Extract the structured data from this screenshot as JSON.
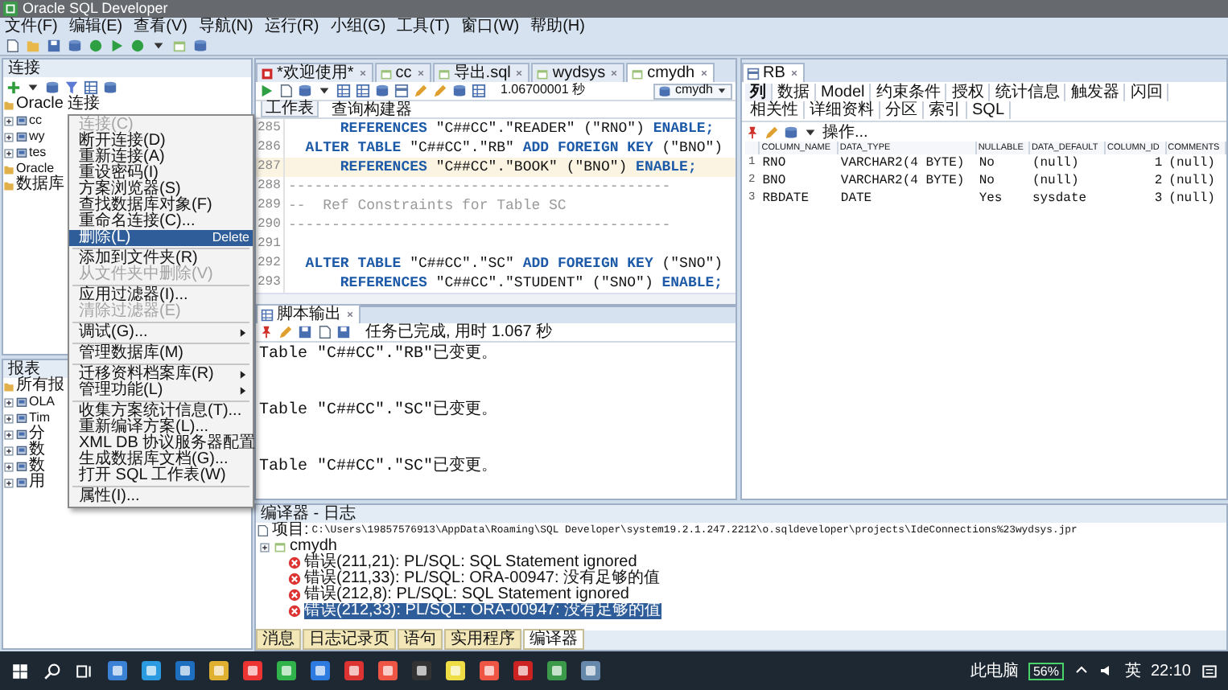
{
  "window": {
    "title": "Oracle SQL Developer"
  },
  "menu_bar": [
    "文件(F)",
    "编辑(E)",
    "查看(V)",
    "导航(N)",
    "运行(R)",
    "小组(G)",
    "工具(T)",
    "窗口(W)",
    "帮助(H)"
  ],
  "connections": {
    "title": "连接",
    "tree": [
      {
        "label": "Oracle 连接",
        "children": [
          {
            "label": "cc"
          },
          {
            "label": "wy"
          },
          {
            "label": "tes"
          }
        ]
      },
      {
        "label": "Oracle"
      },
      {
        "label": "数据库"
      }
    ]
  },
  "reports": {
    "title": "报表",
    "tree": [
      {
        "label": "所有报",
        "children": [
          {
            "label": "OLA"
          },
          {
            "label": "Tim"
          },
          {
            "label": "分"
          },
          {
            "label": "数"
          },
          {
            "label": "数"
          },
          {
            "label": "用"
          }
        ]
      }
    ]
  },
  "context_menu": [
    {
      "kind": "item",
      "label": "连接(C)",
      "disabled": true,
      "selected": false,
      "submenu": false
    },
    {
      "kind": "item",
      "label": "断开连接(D)",
      "disabled": false,
      "selected": false,
      "submenu": false
    },
    {
      "kind": "item",
      "label": "重新连接(A)",
      "disabled": false,
      "selected": false,
      "submenu": false
    },
    {
      "kind": "item",
      "label": "重设密码(I)",
      "disabled": false,
      "selected": false,
      "submenu": false
    },
    {
      "kind": "item",
      "label": "方案浏览器(S)",
      "disabled": false,
      "selected": false,
      "submenu": false
    },
    {
      "kind": "item",
      "label": "查找数据库对象(F)",
      "disabled": false,
      "selected": false,
      "submenu": false
    },
    {
      "kind": "item",
      "label": "重命名连接(C)...",
      "disabled": false,
      "selected": false,
      "submenu": false
    },
    {
      "kind": "item",
      "label": "删除(L)",
      "shortcut": "Delete",
      "disabled": false,
      "selected": true,
      "submenu": false
    },
    {
      "kind": "separator"
    },
    {
      "kind": "item",
      "label": "添加到文件夹(R)",
      "disabled": false,
      "selected": false,
      "submenu": false
    },
    {
      "kind": "item",
      "label": "从文件夹中删除(V)",
      "disabled": true,
      "selected": false,
      "submenu": false
    },
    {
      "kind": "separator"
    },
    {
      "kind": "item",
      "label": "应用过滤器(I)...",
      "disabled": false,
      "selected": false,
      "submenu": false
    },
    {
      "kind": "item",
      "label": "清除过滤器(E)",
      "disabled": true,
      "selected": false,
      "submenu": false
    },
    {
      "kind": "separator"
    },
    {
      "kind": "item",
      "label": "调试(G)...",
      "disabled": false,
      "selected": false,
      "submenu": true
    },
    {
      "kind": "separator"
    },
    {
      "kind": "item",
      "label": "管理数据库(M)",
      "disabled": false,
      "selected": false,
      "submenu": false
    },
    {
      "kind": "separator"
    },
    {
      "kind": "item",
      "label": "迁移资料档案库(R)",
      "disabled": false,
      "selected": false,
      "submenu": true
    },
    {
      "kind": "item",
      "label": "管理功能(L)",
      "disabled": false,
      "selected": false,
      "submenu": true
    },
    {
      "kind": "separator"
    },
    {
      "kind": "item",
      "label": "收集方案统计信息(T)...",
      "disabled": false,
      "selected": false,
      "submenu": false
    },
    {
      "kind": "item",
      "label": "重新编译方案(L)...",
      "disabled": false,
      "selected": false,
      "submenu": false
    },
    {
      "kind": "item",
      "label": "XML DB 协议服务器配置",
      "disabled": false,
      "selected": false,
      "submenu": false
    },
    {
      "kind": "item",
      "label": "生成数据库文档(G)...",
      "disabled": false,
      "selected": false,
      "submenu": false
    },
    {
      "kind": "item",
      "label": "打开 SQL 工作表(W)",
      "disabled": false,
      "selected": false,
      "submenu": false
    },
    {
      "kind": "separator"
    },
    {
      "kind": "item",
      "label": "属性(I)...",
      "disabled": false,
      "selected": false,
      "submenu": false
    }
  ],
  "editor": {
    "tabs": [
      {
        "label": "*欢迎使用*",
        "selected": false
      },
      {
        "label": "cc",
        "selected": false
      },
      {
        "label": "导出.sql",
        "selected": false
      },
      {
        "label": "wydsys",
        "selected": false
      },
      {
        "label": "cmydh",
        "selected": true
      }
    ],
    "timing": "1.06700001 秒",
    "connection": "cmydh",
    "subtabs": [
      {
        "label": "工作表",
        "selected": true
      },
      {
        "label": "查询构建器",
        "selected": false
      }
    ],
    "lines": [
      {
        "number": "285",
        "highlighted": false,
        "tokens": [
          {
            "kind": "keyword",
            "text": "      REFERENCES"
          },
          {
            "kind": "plain",
            "text": " \"C##CC\".\"READER\" (\"RNO\") "
          },
          {
            "kind": "keyword",
            "text": "ENABLE;"
          }
        ]
      },
      {
        "number": "286",
        "highlighted": false,
        "tokens": [
          {
            "kind": "keyword",
            "text": "  ALTER TABLE"
          },
          {
            "kind": "plain",
            "text": " \"C##CC\".\"RB\" "
          },
          {
            "kind": "keyword",
            "text": "ADD FOREIGN KEY"
          },
          {
            "kind": "plain",
            "text": " (\"BNO\")"
          }
        ]
      },
      {
        "number": "287",
        "highlighted": true,
        "tokens": [
          {
            "kind": "keyword",
            "text": "      REFERENCES"
          },
          {
            "kind": "plain",
            "text": " \"C##CC\".\"BOOK\" (\"BNO\") "
          },
          {
            "kind": "keyword",
            "text": "ENABLE;"
          }
        ]
      },
      {
        "number": "288",
        "highlighted": false,
        "tokens": [
          {
            "kind": "comment",
            "text": "--------------------------------------------"
          }
        ]
      },
      {
        "number": "289",
        "highlighted": false,
        "tokens": [
          {
            "kind": "comment",
            "text": "--  Ref Constraints for Table SC"
          }
        ]
      },
      {
        "number": "290",
        "highlighted": false,
        "tokens": [
          {
            "kind": "comment",
            "text": "--------------------------------------------"
          }
        ]
      },
      {
        "number": "291",
        "highlighted": false
      },
      {
        "number": "292",
        "highlighted": false,
        "tokens": [
          {
            "kind": "keyword",
            "text": "  ALTER TABLE"
          },
          {
            "kind": "plain",
            "text": " \"C##CC\".\"SC\" "
          },
          {
            "kind": "keyword",
            "text": "ADD FOREIGN KEY"
          },
          {
            "kind": "plain",
            "text": " (\"SNO\")"
          }
        ]
      },
      {
        "number": "293",
        "highlighted": false,
        "tokens": [
          {
            "kind": "keyword",
            "text": "      REFERENCES"
          },
          {
            "kind": "plain",
            "text": " \"C##CC\".\"STUDENT\" (\"SNO\") "
          },
          {
            "kind": "keyword",
            "text": "ENABLE;"
          }
        ]
      }
    ]
  },
  "script_output": {
    "tab": "脚本输出",
    "status": "任务已完成, 用时 1.067 秒",
    "lines": [
      "Table \"C##CC\".\"RB\"已变更。",
      "Table \"C##CC\".\"SC\"已变更。",
      "Table \"C##CC\".\"SC\"已变更。"
    ]
  },
  "object_panel": {
    "tab": "RB",
    "subtabs": [
      {
        "label": "列",
        "selected": true
      },
      {
        "label": "数据",
        "selected": false
      },
      {
        "label": "Model",
        "selected": false
      },
      {
        "label": "约束条件",
        "selected": false
      },
      {
        "label": "授权",
        "selected": false
      },
      {
        "label": "统计信息",
        "selected": false
      },
      {
        "label": "触发器",
        "selected": false
      },
      {
        "label": "闪回",
        "selected": false
      },
      {
        "label": "相关性",
        "selected": false
      },
      {
        "label": "详细资料",
        "selected": false
      },
      {
        "label": "分区",
        "selected": false
      },
      {
        "label": "索引",
        "selected": false
      },
      {
        "label": "SQL",
        "selected": false
      }
    ],
    "actions": "操作...",
    "columns": [
      "COLUMN_NAME",
      "DATA_TYPE",
      "NULLABLE",
      "DATA_DEFAULT",
      "COLUMN_ID",
      "COMMENTS"
    ],
    "rows": [
      {
        "number": "1",
        "cells": [
          "RNO",
          "VARCHAR2(4 BYTE)",
          "No",
          "(null)",
          "1",
          "(null)"
        ]
      },
      {
        "number": "2",
        "cells": [
          "BNO",
          "VARCHAR2(4 BYTE)",
          "No",
          "(null)",
          "2",
          "(null)"
        ]
      },
      {
        "number": "3",
        "cells": [
          "RBDATE",
          "DATE",
          "Yes",
          "sysdate",
          "3",
          "(null)"
        ]
      }
    ]
  },
  "compiler_log": {
    "title": "编译器 - 日志",
    "project_label": "项目:",
    "project_path": "C:\\Users\\19857576913\\AppData\\Roaming\\SQL Developer\\system19.2.1.247.2212\\o.sqldeveloper\\projects\\IdeConnections%23wydsys.jpr",
    "node": "cmydh",
    "messages": [
      {
        "text": "错误(211,21): PL/SQL: SQL Statement ignored",
        "selected": false
      },
      {
        "text": "错误(211,33): PL/SQL: ORA-00947: 没有足够的值",
        "selected": false
      },
      {
        "text": "错误(212,8): PL/SQL: SQL Statement ignored",
        "selected": false
      },
      {
        "text": "错误(212,33): PL/SQL: ORA-00947: 没有足够的值",
        "selected": true
      }
    ]
  },
  "bottom_tabs": [
    {
      "label": "消息",
      "selected": false
    },
    {
      "label": "日志记录页",
      "selected": false
    },
    {
      "label": "语句",
      "selected": false
    },
    {
      "label": "实用程序",
      "selected": false
    },
    {
      "label": "编译器",
      "selected": true
    }
  ],
  "taskbar": {
    "tray_label": "此电脑",
    "battery": "56%",
    "ime": "英",
    "clock": "22:10"
  }
}
